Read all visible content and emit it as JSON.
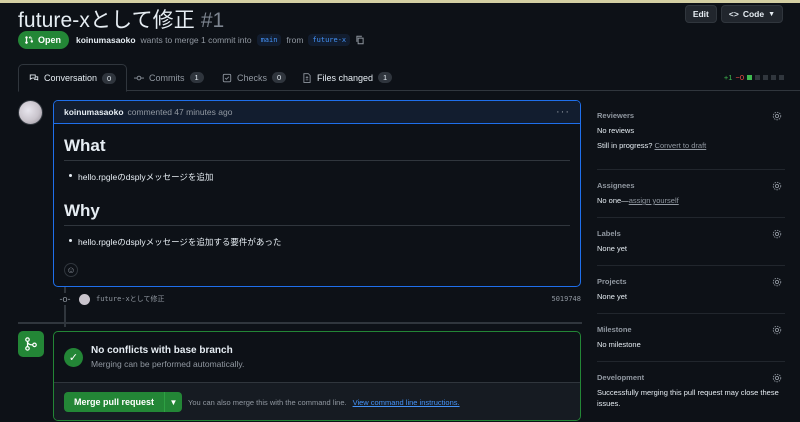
{
  "pr": {
    "title": "future-xとして修正",
    "number": "#1",
    "state": "Open",
    "author": "koinumasaoko",
    "merge_text": "wants to merge 1 commit into",
    "base_branch": "main",
    "from_text": "from",
    "head_branch": "future-x"
  },
  "header_buttons": {
    "edit": "Edit",
    "code": "Code"
  },
  "tabs": [
    {
      "label": "Conversation",
      "count": "0"
    },
    {
      "label": "Commits",
      "count": "1"
    },
    {
      "label": "Checks",
      "count": "0"
    },
    {
      "label": "Files changed",
      "count": "1"
    }
  ],
  "diffstat": {
    "additions": "+1",
    "deletions": "−0"
  },
  "comment": {
    "author": "koinumasaoko",
    "meta": "commented 47 minutes ago",
    "h1_what": "What",
    "item_what": "hello.rpgleのdsplyメッセージを追加",
    "h1_why": "Why",
    "item_why": "hello.rpgleのdsplyメッセージを追加する要件があった"
  },
  "commit": {
    "message": "future-xとして修正",
    "sha": "5019748"
  },
  "merge": {
    "status_title": "No conflicts with base branch",
    "status_sub": "Merging can be performed automatically.",
    "button": "Merge pull request",
    "hint": "You can also merge this with the command line.",
    "hint_link": "View command line instructions."
  },
  "sidebar": {
    "reviewers": {
      "title": "Reviewers",
      "value": "No reviews",
      "extra": "Still in progress?",
      "extra_link": "Convert to draft"
    },
    "assignees": {
      "title": "Assignees",
      "value": "No one—",
      "value_link": "assign yourself"
    },
    "labels": {
      "title": "Labels",
      "value": "None yet"
    },
    "projects": {
      "title": "Projects",
      "value": "None yet"
    },
    "milestone": {
      "title": "Milestone",
      "value": "No milestone"
    },
    "development": {
      "title": "Development",
      "value": "Successfully merging this pull request may close these issues."
    }
  },
  "colors": {
    "accent_green": "#238636",
    "accent_blue": "#1f6feb",
    "link": "#4493f8",
    "bg": "#0d1117"
  }
}
